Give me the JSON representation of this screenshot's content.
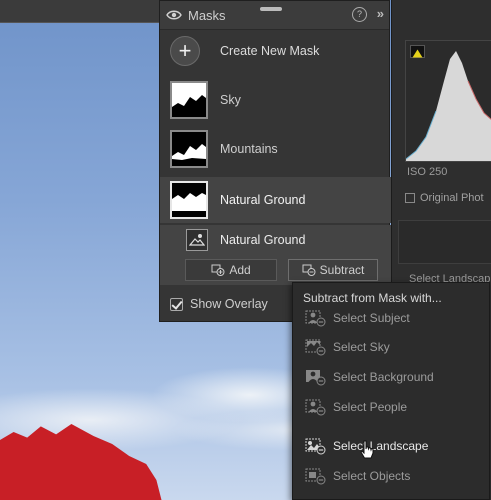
{
  "masks_panel": {
    "title": "Masks",
    "create_new_mask": "Create New Mask",
    "masks": [
      {
        "label": "Sky"
      },
      {
        "label": "Mountains"
      },
      {
        "label": "Natural Ground"
      }
    ],
    "submask": {
      "label": "Natural Ground"
    },
    "add_label": "Add",
    "subtract_label": "Subtract",
    "show_overlay_label": "Show Overlay"
  },
  "right_panel": {
    "iso": "ISO 250",
    "original_photo": "Original Phot",
    "select_landscape_partial": "Select Landscap"
  },
  "menu": {
    "title": "Subtract from Mask with...",
    "items": [
      {
        "label": "Select Subject",
        "icon": "subject-icon"
      },
      {
        "label": "Select Sky",
        "icon": "sky-icon"
      },
      {
        "label": "Select Background",
        "icon": "background-icon"
      },
      {
        "label": "Select People",
        "icon": "people-icon"
      },
      {
        "label": "Select Landscape",
        "icon": "landscape-icon"
      },
      {
        "label": "Select Objects",
        "icon": "objects-icon"
      }
    ]
  }
}
